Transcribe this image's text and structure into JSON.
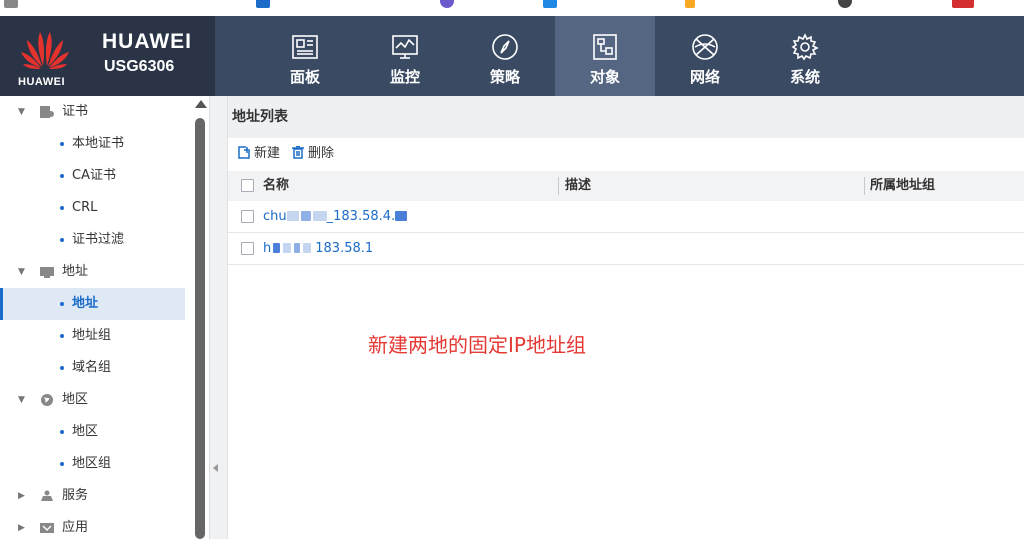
{
  "brand": {
    "name": "HUAWEI",
    "model": "USG6306",
    "logo_word": "HUAWEI",
    "colors": {
      "header_bg": "#3a4a63",
      "logo_bg": "#2a3446",
      "active_tab": "#556682",
      "accent": "#1a6cc8",
      "annotation": "#e53935"
    }
  },
  "nav": {
    "items": [
      {
        "label": "面板",
        "icon": "dashboard-icon",
        "active": false
      },
      {
        "label": "监控",
        "icon": "monitor-icon",
        "active": false
      },
      {
        "label": "策略",
        "icon": "compass-icon",
        "active": false
      },
      {
        "label": "对象",
        "icon": "object-icon",
        "active": true
      },
      {
        "label": "网络",
        "icon": "network-icon",
        "active": false
      },
      {
        "label": "系统",
        "icon": "gear-icon",
        "active": false
      }
    ]
  },
  "sidebar": {
    "groups": [
      {
        "label": "证书",
        "icon": "certificate-icon",
        "expanded": true,
        "items": [
          "本地证书",
          "CA证书",
          "CRL",
          "证书过滤"
        ]
      },
      {
        "label": "地址",
        "icon": "address-icon",
        "expanded": true,
        "items": [
          "地址",
          "地址组",
          "域名组"
        ],
        "selected": "地址"
      },
      {
        "label": "地区",
        "icon": "globe-icon",
        "expanded": true,
        "items": [
          "地区",
          "地区组"
        ]
      },
      {
        "label": "服务",
        "icon": "service-icon",
        "expanded": false,
        "items": []
      },
      {
        "label": "应用",
        "icon": "application-icon",
        "expanded": false,
        "items": []
      }
    ]
  },
  "main": {
    "title": "地址列表",
    "toolbar": {
      "new_label": "新建",
      "delete_label": "删除"
    },
    "table": {
      "columns": [
        "名称",
        "描述",
        "所属地址组"
      ],
      "rows": [
        {
          "name_prefix": "chu",
          "name_suffix": "_183.58.4."
        },
        {
          "name_prefix": "h",
          "name_suffix": "183.58.1"
        }
      ]
    },
    "annotation": "新建两地的固定IP地址组"
  }
}
